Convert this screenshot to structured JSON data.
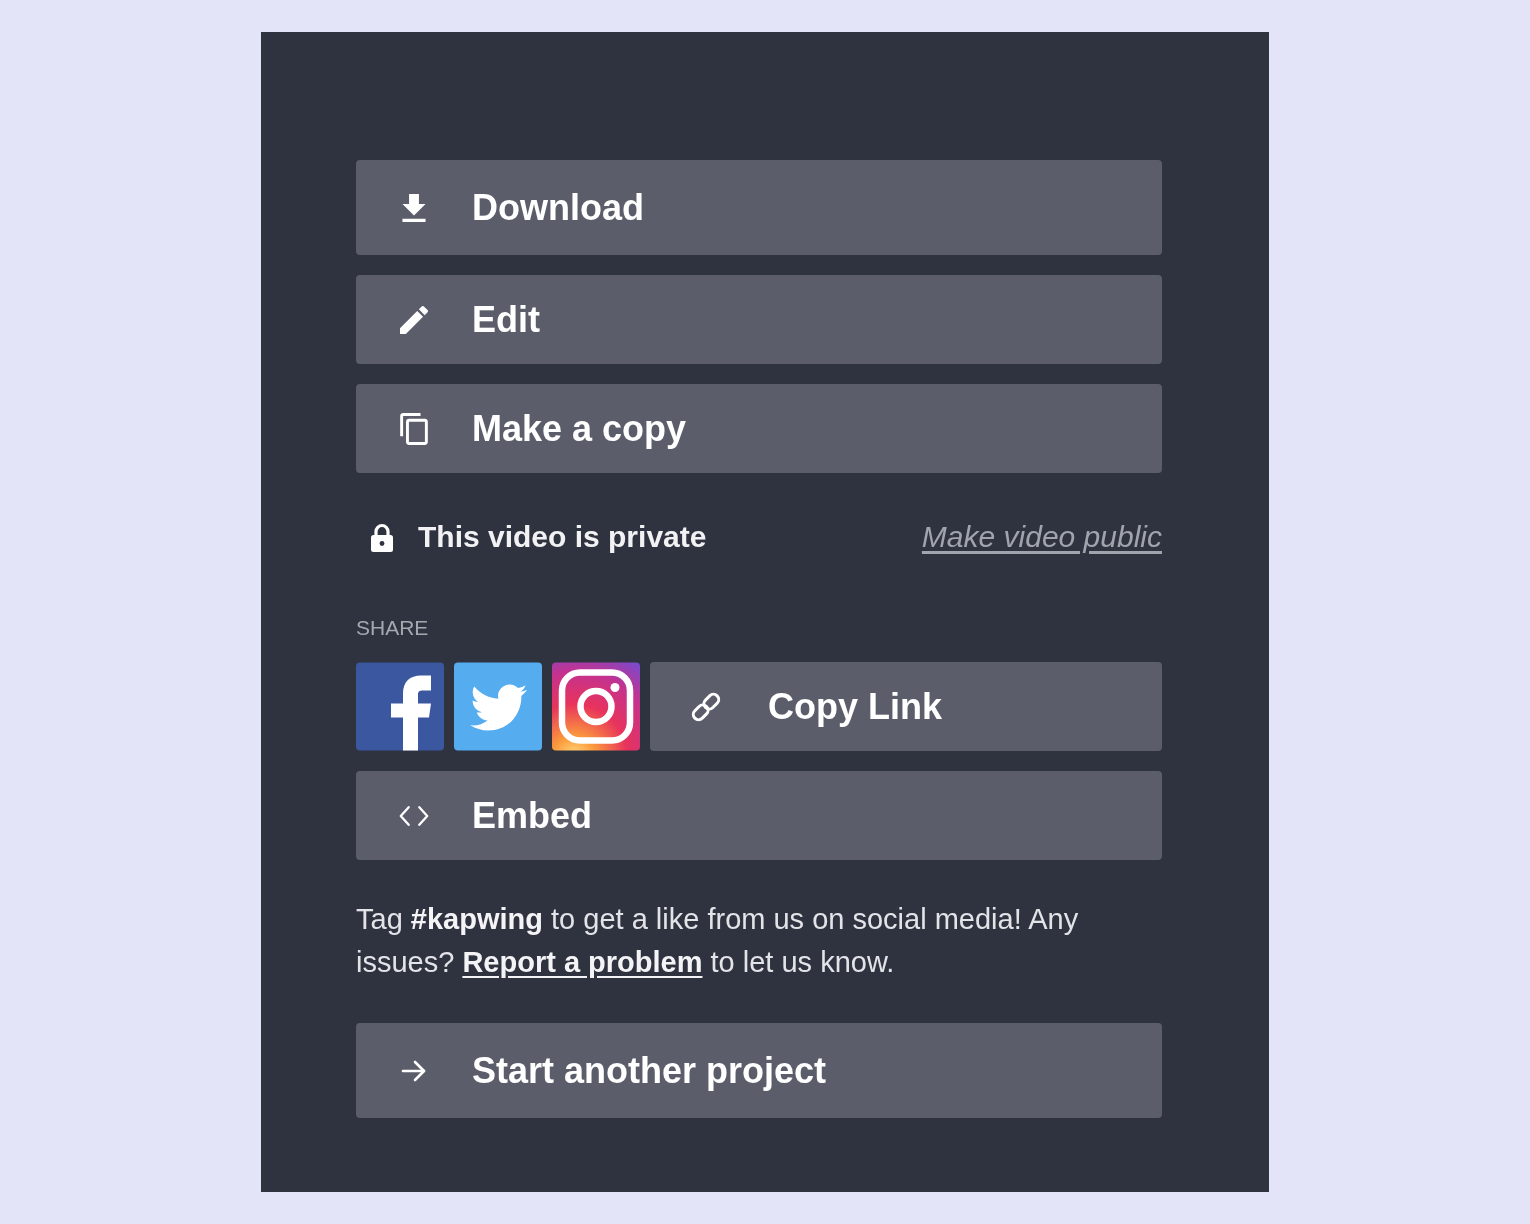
{
  "actions": [
    {
      "kind": "download",
      "label": "Download"
    },
    {
      "kind": "edit",
      "label": "Edit"
    },
    {
      "kind": "copy",
      "label": "Make a copy"
    }
  ],
  "privacy": {
    "status": "This video is private",
    "link": "Make video public"
  },
  "share": {
    "heading": "SHARE",
    "copy_link": "Copy Link",
    "embed": "Embed"
  },
  "note": {
    "text": "Tag **#kapwing** to get a like from us on social media! Any issues?",
    "link": "Report a problem",
    "text_after": "to let us know."
  },
  "footer_button": {
    "label": "Start another project"
  }
}
